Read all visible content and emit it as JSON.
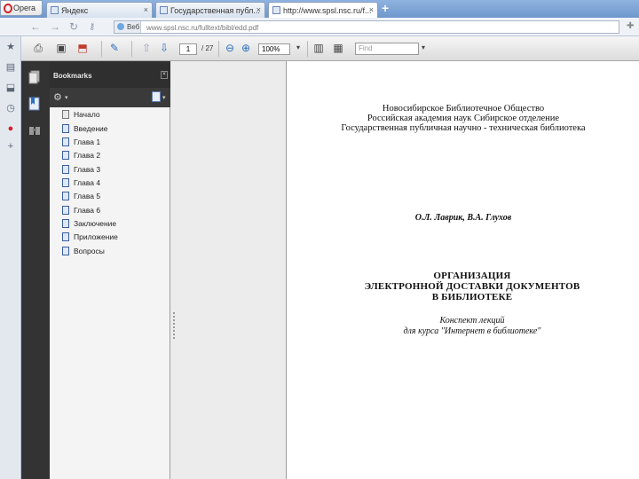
{
  "browser": {
    "menu_label": "Opera",
    "tabs": [
      {
        "title": "Яндекс",
        "active": false
      },
      {
        "title": "Государственная публ...",
        "active": false
      },
      {
        "title": "http://www.spsl.nsc.ru/f...",
        "active": true
      }
    ],
    "address": {
      "badge": "Веб",
      "url": "www.spsl.nsc.ru/fulltext/bibl/edd.pdf"
    }
  },
  "acrobat": {
    "page_current": "1",
    "page_total": "/ 27",
    "zoom": "100%",
    "find_placeholder": "Find",
    "bookmarks_title": "Bookmarks",
    "bookmarks": [
      {
        "label": "Начало",
        "icon": "plain"
      },
      {
        "label": "Введение",
        "icon": "bookmark"
      },
      {
        "label": "Глава 1",
        "icon": "bookmark"
      },
      {
        "label": "Глава 2",
        "icon": "bookmark"
      },
      {
        "label": "Глава 3",
        "icon": "bookmark"
      },
      {
        "label": "Глава 4",
        "icon": "bookmark"
      },
      {
        "label": "Глава 5",
        "icon": "bookmark"
      },
      {
        "label": "Глава 6",
        "icon": "bookmark"
      },
      {
        "label": "Заключение",
        "icon": "bookmark"
      },
      {
        "label": "Приложение",
        "icon": "bookmark"
      },
      {
        "label": "Вопросы",
        "icon": "bookmark"
      }
    ]
  },
  "document": {
    "org_lines": [
      "Новосибирское Библиотечное Общество",
      "Российская академия наук Сибирское отделение",
      "Государственная публичная научно - техническая библиотека"
    ],
    "authors": "О.Л. Лаврик, В.А. Глухов",
    "title_lines": [
      "ОРГАНИЗАЦИЯ",
      "ЭЛЕКТРОННОЙ ДОСТАВКИ ДОКУМЕНТОВ",
      "В БИБЛИОТЕКЕ"
    ],
    "subtitle_lines": [
      "Конспект лекций",
      "для курса \"Интернет в библиотеке\""
    ]
  }
}
